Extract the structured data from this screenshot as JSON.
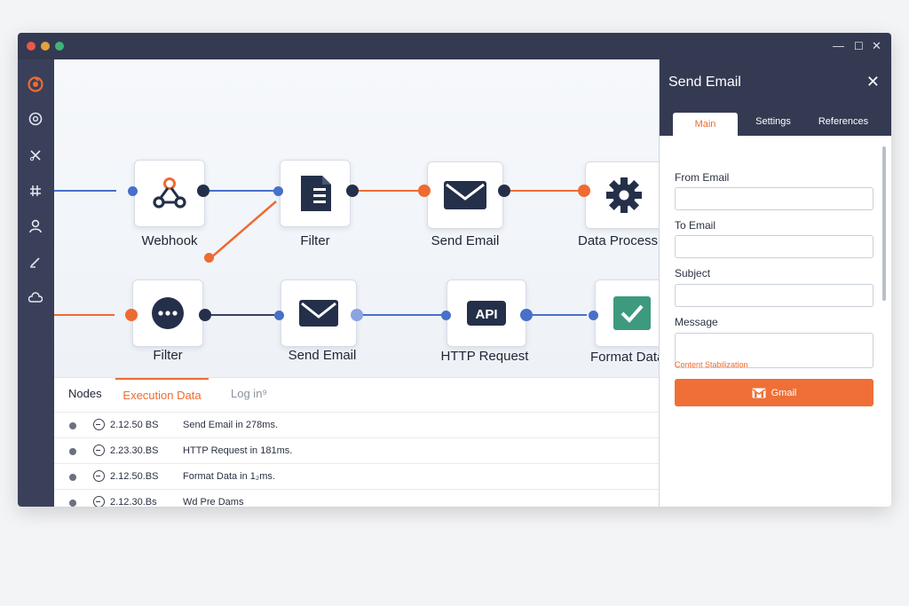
{
  "colors": {
    "accent": "#ee6b32",
    "navy": "#343a52",
    "connector_blue": "#4770c8",
    "node_icon_dark": "#243049",
    "check_green": "#3d9a7e"
  },
  "canvas": {
    "nodes": [
      {
        "label": "Webhook",
        "icon": "webhook-icon"
      },
      {
        "label": "Filter",
        "icon": "document-icon"
      },
      {
        "label": "Send Email",
        "icon": "envelope-icon"
      },
      {
        "label": "Data Processing",
        "icon": "gear-icon"
      },
      {
        "label": "Filter",
        "icon": "more-dots-icon"
      },
      {
        "label": "Send Email",
        "icon": "envelope-icon"
      },
      {
        "label": "HTTP Request",
        "icon": "api-icon",
        "icon_text": "API"
      },
      {
        "label": "Format Data",
        "icon": "check-icon"
      }
    ]
  },
  "log_panel": {
    "tabs": [
      {
        "label": "Nodes",
        "active": false
      },
      {
        "label": "Execution Data",
        "active": true
      },
      {
        "label": "Log in⁹",
        "active": false
      }
    ],
    "rows": [
      {
        "time": "2.12.50 BS",
        "message": "Send Email in 278ms."
      },
      {
        "time": "2.23.30.BS",
        "message": "HTTP Request in 181ms."
      },
      {
        "time": "2.12.50.BS",
        "message": "Format Data in 1₂ms."
      },
      {
        "time": "2.12.30.Bs",
        "message": "Wd Pre Dams"
      }
    ]
  },
  "panel": {
    "title": "Send Email",
    "close": "✕",
    "tabs": [
      {
        "label": "Main",
        "active": true
      },
      {
        "label": "Settings",
        "active": false
      },
      {
        "label": "References",
        "active": false
      }
    ],
    "fields": [
      {
        "label": "From Email",
        "value": ""
      },
      {
        "label": "To Email",
        "value": ""
      },
      {
        "label": "Subject",
        "value": ""
      },
      {
        "label": "Message",
        "value": ""
      }
    ],
    "hint": "Content Stabilization",
    "button": {
      "label": "Gmail",
      "icon": "gmail-icon"
    }
  },
  "window_controls": {
    "minimize": "—",
    "maximize": "☐",
    "close": "✕"
  }
}
